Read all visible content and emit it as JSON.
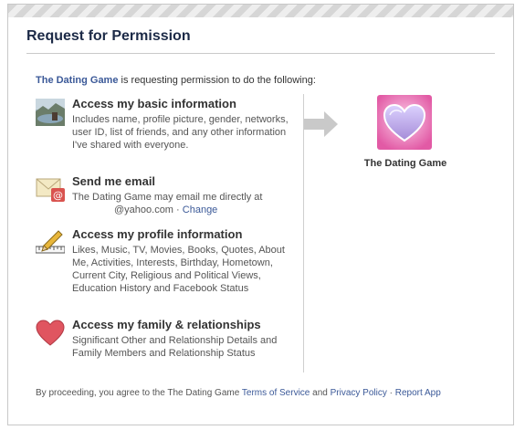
{
  "dialog": {
    "title": "Request for Permission",
    "intro_app": "The Dating Game",
    "intro_rest": " is requesting permission to do the following:"
  },
  "permissions": [
    {
      "icon": "photo-icon",
      "title": "Access my basic information",
      "description": "Includes name, profile picture, gender, networks, user ID, list of friends, and any other information I've shared with everyone."
    },
    {
      "icon": "envelope-icon",
      "title": "Send me email",
      "description": "The Dating Game may email me directly at",
      "email": "@yahoo.com",
      "separator": " · ",
      "change_label": "Change"
    },
    {
      "icon": "ruler-pencil-icon",
      "title": "Access my profile information",
      "description": "Likes, Music, TV, Movies, Books, Quotes, About Me, Activities, Interests, Birthday, Hometown, Current City, Religious and Political Views, Education History and Facebook Status"
    },
    {
      "icon": "heart-icon",
      "title": "Access my family & relationships",
      "description": "Significant Other and Relationship Details and Family Members and Relationship Status"
    }
  ],
  "app": {
    "name": "The Dating Game",
    "icon": "heart-app-icon"
  },
  "footer": {
    "prefix": "By proceeding, you agree to the The Dating Game ",
    "terms": "Terms of Service",
    "and": " and ",
    "privacy": "Privacy Policy",
    "sep": " · ",
    "report": "Report App"
  },
  "colors": {
    "link": "#3b5998",
    "title": "#1c2a47",
    "heart": "#e05560",
    "app_icon_bg": "#e75fa6"
  }
}
